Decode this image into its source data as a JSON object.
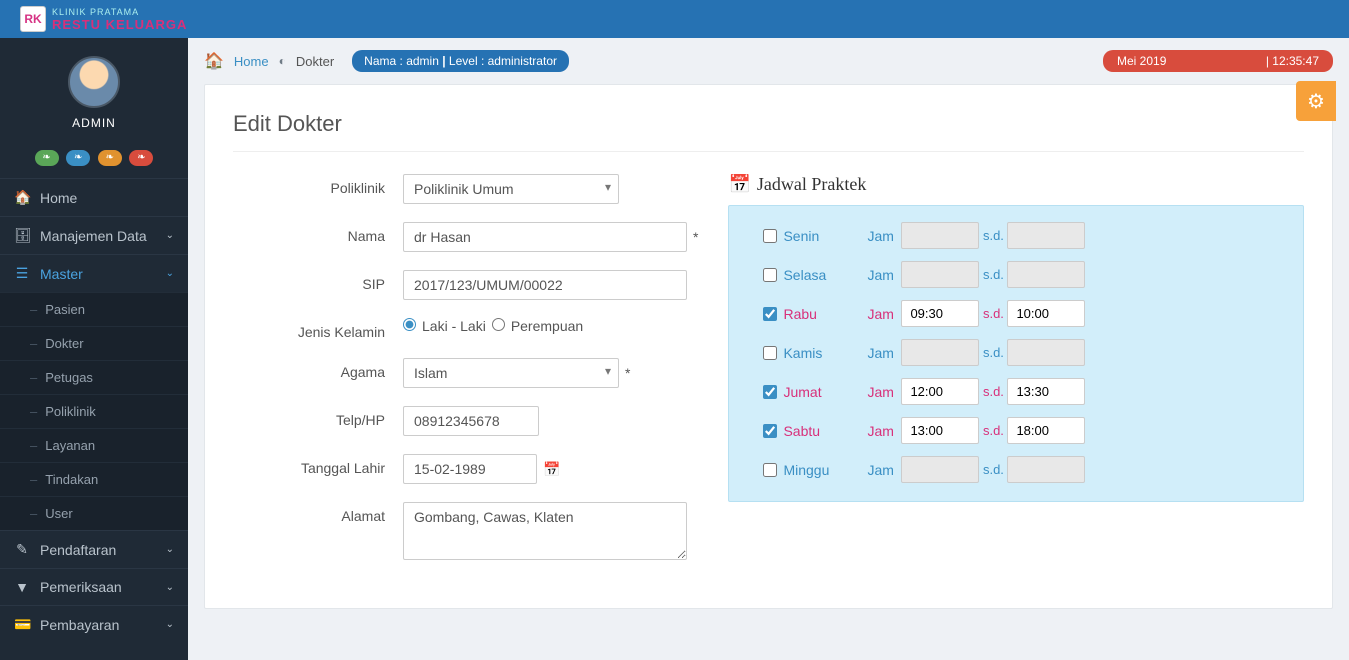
{
  "brand": {
    "top": "KLINIK PRATAMA",
    "main": "RESTU KELUARGA",
    "badge": "RK"
  },
  "user": {
    "name": "ADMIN"
  },
  "breadcrumb": {
    "home": "Home",
    "current": "Dokter"
  },
  "session_badge": {
    "nama_label": "Nama :",
    "nama_value": "admin",
    "level_label": "Level :",
    "level_value": "administrator"
  },
  "date_badge": {
    "month": "Mei 2019",
    "time": "| 12:35:47"
  },
  "sidebar": {
    "items": [
      {
        "label": "Home",
        "icon": "home"
      },
      {
        "label": "Manajemen Data",
        "icon": "drive",
        "expandable": true
      },
      {
        "label": "Master",
        "icon": "list",
        "expandable": true,
        "active": true
      },
      {
        "label": "Pendaftaran",
        "icon": "edit",
        "expandable": true
      },
      {
        "label": "Pemeriksaan",
        "icon": "filter",
        "expandable": true
      },
      {
        "label": "Pembayaran",
        "icon": "card",
        "expandable": true
      }
    ],
    "master_sub": [
      {
        "label": "Pasien"
      },
      {
        "label": "Dokter"
      },
      {
        "label": "Petugas"
      },
      {
        "label": "Poliklinik"
      },
      {
        "label": "Layanan"
      },
      {
        "label": "Tindakan"
      },
      {
        "label": "User"
      }
    ]
  },
  "page": {
    "title": "Edit Dokter"
  },
  "form": {
    "labels": {
      "poliklinik": "Poliklinik",
      "nama": "Nama",
      "sip": "SIP",
      "jk": "Jenis Kelamin",
      "agama": "Agama",
      "telp": "Telp/HP",
      "tgl_lahir": "Tanggal Lahir",
      "alamat": "Alamat"
    },
    "values": {
      "poliklinik": "Poliklinik Umum",
      "nama": "dr Hasan",
      "sip": "2017/123/UMUM/00022",
      "jk_laki": "Laki - Laki",
      "jk_perempuan": "Perempuan",
      "agama": "Islam",
      "telp": "08912345678",
      "tgl_lahir": "15-02-1989",
      "alamat": "Gombang, Cawas, Klaten"
    }
  },
  "jadwal": {
    "title": "Jadwal Praktek",
    "jam_label": "Jam",
    "sd_label": "s.d.",
    "days": [
      {
        "name": "Senin",
        "checked": false,
        "from": "",
        "to": ""
      },
      {
        "name": "Selasa",
        "checked": false,
        "from": "",
        "to": ""
      },
      {
        "name": "Rabu",
        "checked": true,
        "from": "09:30",
        "to": "10:00"
      },
      {
        "name": "Kamis",
        "checked": false,
        "from": "",
        "to": ""
      },
      {
        "name": "Jumat",
        "checked": true,
        "from": "12:00",
        "to": "13:30"
      },
      {
        "name": "Sabtu",
        "checked": true,
        "from": "13:00",
        "to": "18:00"
      },
      {
        "name": "Minggu",
        "checked": false,
        "from": "",
        "to": ""
      }
    ]
  }
}
